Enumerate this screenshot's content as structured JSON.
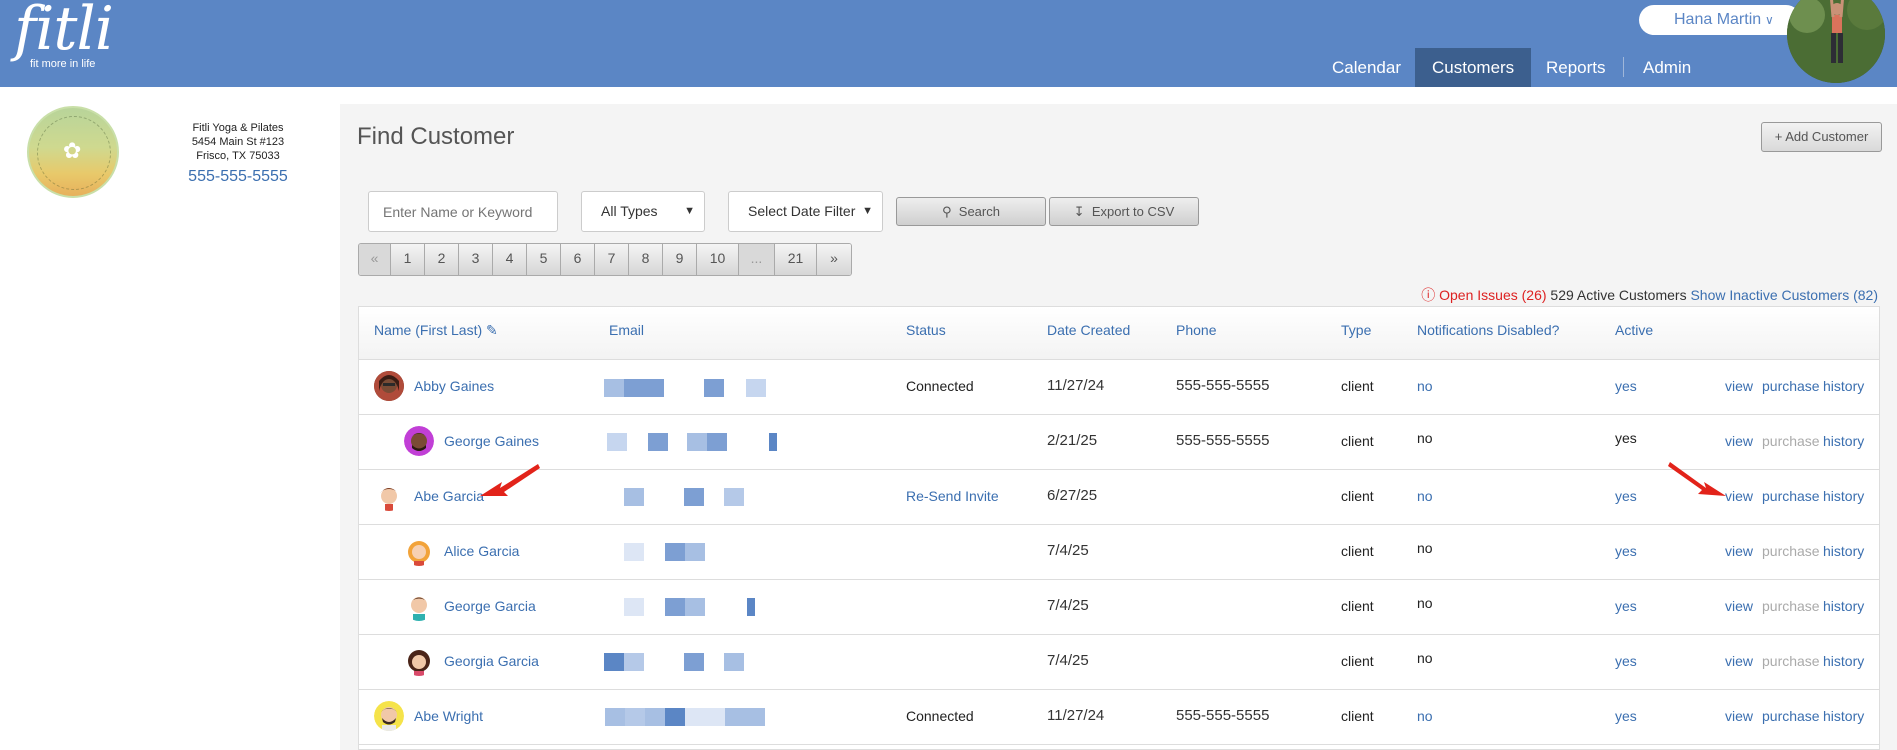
{
  "header": {
    "logo_text": "fitli",
    "logo_tagline": "fit more in life",
    "user_name": "Hana Martin",
    "nav": [
      "Calendar",
      "Customers",
      "Reports",
      "Admin"
    ]
  },
  "studio": {
    "name": "Fitli Yoga & Pilates",
    "address1": "5454 Main St #123",
    "address2": "Frisco, TX 75033",
    "phone": "555-555-5555"
  },
  "page": {
    "title": "Find Customer",
    "add_button": "+ Add Customer",
    "search_placeholder": "Enter Name or Keyword",
    "type_select": "All Types",
    "date_select": "Select Date Filter",
    "search_button": "Search",
    "export_button": "Export to CSV"
  },
  "pager": [
    "«",
    "1",
    "2",
    "3",
    "4",
    "5",
    "6",
    "7",
    "8",
    "9",
    "10",
    "...",
    "21",
    "»"
  ],
  "stats": {
    "open_issues": "Open Issues (26)",
    "active_customers": "529 Active Customers",
    "show_inactive": "Show Inactive Customers (82)"
  },
  "columns": [
    "Name (First Last)",
    "Email",
    "Status",
    "Date Created",
    "Phone",
    "Type",
    "Notifications Disabled?",
    "Active"
  ],
  "actions": {
    "view": "view",
    "purchase": "purchase",
    "history": "history"
  },
  "rows": [
    {
      "name": "Abby Gaines",
      "status": "Connected",
      "date": "11/27/24",
      "phone": "555-555-5555",
      "type": "client",
      "notif": "no",
      "active": "yes",
      "child": false
    },
    {
      "name": "George Gaines",
      "status": "",
      "date": "2/21/25",
      "phone": "555-555-5555",
      "type": "client",
      "notif": "no",
      "active": "yes",
      "child": true
    },
    {
      "name": "Abe Garcia",
      "status": "Re-Send Invite",
      "date": "6/27/25",
      "phone": "",
      "type": "client",
      "notif": "no",
      "active": "yes",
      "child": false
    },
    {
      "name": "Alice Garcia",
      "status": "",
      "date": "7/4/25",
      "phone": "",
      "type": "client",
      "notif": "no",
      "active": "yes",
      "child": true
    },
    {
      "name": "George Garcia",
      "status": "",
      "date": "7/4/25",
      "phone": "",
      "type": "client",
      "notif": "no",
      "active": "yes",
      "child": true
    },
    {
      "name": "Georgia Garcia",
      "status": "",
      "date": "7/4/25",
      "phone": "",
      "type": "client",
      "notif": "no",
      "active": "yes",
      "child": true
    },
    {
      "name": "Abe Wright",
      "status": "Connected",
      "date": "11/27/24",
      "phone": "555-555-5555",
      "type": "client",
      "notif": "no",
      "active": "yes",
      "child": false
    }
  ]
}
